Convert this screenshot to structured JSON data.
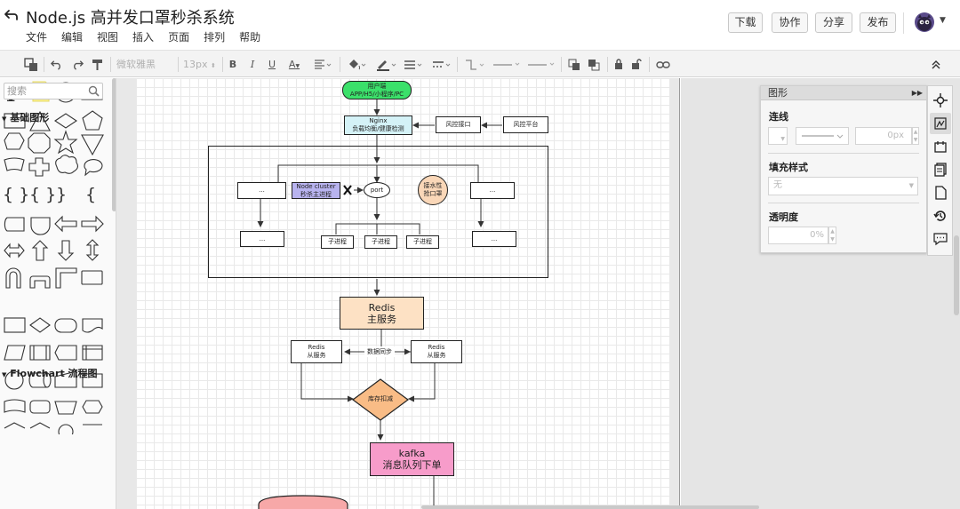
{
  "header": {
    "back_icon": "back-arrow-icon",
    "title": "Node.js 高并发口罩秒杀系统",
    "menu": [
      "文件",
      "编辑",
      "视图",
      "插入",
      "页面",
      "排列",
      "帮助"
    ],
    "buttons": {
      "download": "下载",
      "collaborate": "协作",
      "share": "分享",
      "publish": "发布"
    },
    "avatar_icon": "user-avatar-icon"
  },
  "toolbar": {
    "font_family": "微软雅黑",
    "font_size": "13px",
    "bold": "B",
    "italic": "I",
    "underline": "U",
    "text_color": "A"
  },
  "sidebar": {
    "search_placeholder": "搜索",
    "sections": {
      "basic": "基础图形",
      "flowchart": "Flowchart 流程图"
    },
    "text_tool": "T"
  },
  "diagram": {
    "client": "用户端\nAPP/H5/小程序/PC",
    "nginx": "Nginx\n负载均衡/健康检测",
    "risk_api": "风控接口",
    "risk_platform": "风控平台",
    "dots": "...",
    "node_cluster": "Node cluster\n秒杀主进程",
    "port": "port",
    "mask": "接水性\n抢口罩",
    "child_process": "子进程",
    "redis_main": "Redis\n主服务",
    "redis_slave": "Redis\n从服务",
    "data_sync": "数据同步",
    "stock": "库存扣减",
    "kafka": "kafka\n消息队列下单",
    "colors": {
      "client": "#3be06a",
      "nginx": "#d4f2f7",
      "cluster": "#b8b3ef",
      "mask": "#fad7b8",
      "redis_main": "#fde1c4",
      "stock": "#f9bc86",
      "kafka": "#f79cca",
      "db": "#f7a8a8"
    }
  },
  "format_panel": {
    "title": "图形",
    "line_label": "连线",
    "line_width_value": "0px",
    "fill_label": "填充样式",
    "fill_value": "无",
    "opacity_label": "透明度",
    "opacity_value": "0%"
  }
}
